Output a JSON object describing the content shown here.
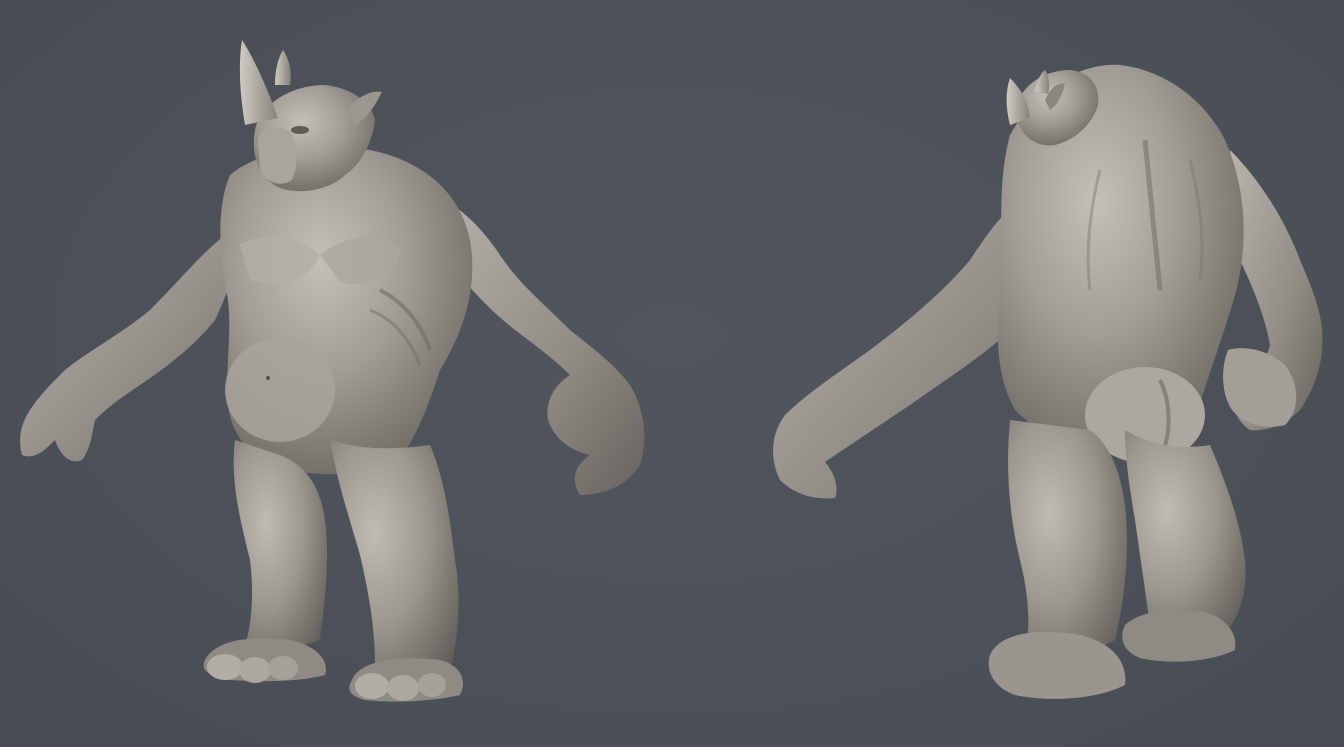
{
  "scene": {
    "background_color": "#4d5159",
    "clay_color": "#9a958f",
    "clay_highlight": "#c2beb7",
    "clay_shadow": "#5e5a55",
    "views": [
      {
        "name": "front-three-quarter-view"
      },
      {
        "name": "back-three-quarter-view"
      }
    ]
  }
}
